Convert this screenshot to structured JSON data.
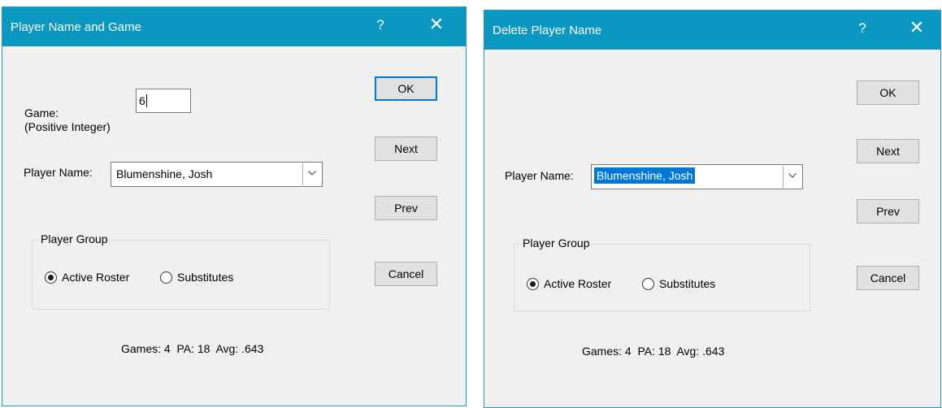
{
  "dialog1": {
    "title": "Player Name and Game",
    "help": "?",
    "close": "✕",
    "game_label": "Game:\n(Positive Integer)",
    "game_value": "6",
    "player_name_label": "Player Name:",
    "player_name_value": "Blumenshine, Josh",
    "buttons": {
      "ok": "OK",
      "next": "Next",
      "prev": "Prev",
      "cancel": "Cancel"
    },
    "group_title": "Player Group",
    "radio_active": "Active Roster",
    "radio_subs": "Substitutes",
    "stats": "Games: 4  PA: 18  Avg: .643"
  },
  "dialog2": {
    "title": "Delete Player Name",
    "help": "?",
    "close": "✕",
    "player_name_label": "Player Name:",
    "player_name_value": "Blumenshine, Josh",
    "buttons": {
      "ok": "OK",
      "next": "Next",
      "prev": "Prev",
      "cancel": "Cancel"
    },
    "group_title": "Player Group",
    "radio_active": "Active Roster",
    "radio_subs": "Substitutes",
    "stats": "Games: 4  PA: 18  Avg: .643"
  },
  "colors": {
    "titlebar": "#0a98c1",
    "selection": "#0078d7",
    "dialog_bg": "#f0f0f0"
  }
}
